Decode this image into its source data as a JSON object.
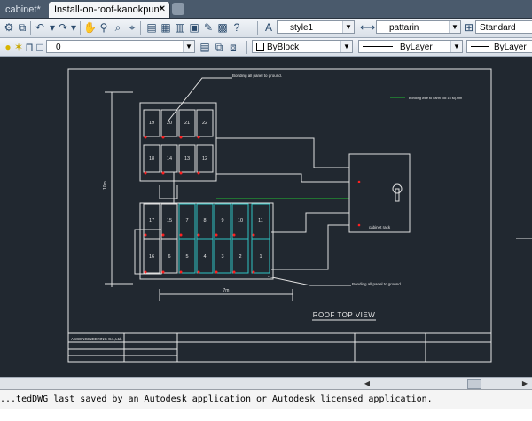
{
  "tabs": [
    {
      "label": "cabinet*",
      "active": false
    },
    {
      "label": "Install-on-roof-kanokpun*",
      "active": true
    }
  ],
  "toolbar": {
    "text_style": "style1",
    "dim_style": "pattarin",
    "table_style": "Standard",
    "layer": "0",
    "color": "ByBlock",
    "linetype": "ByLayer",
    "lineweight": "ByLayer"
  },
  "drawing": {
    "annotation_top": "Bonding all panel to ground.",
    "annotation_bottom": "Bonding all panel to ground.",
    "legend_text": "Bonding wire to earth rod 16 sq.mm",
    "legend_color": "#22bb33",
    "cabinet_label": "cabinet rack",
    "dimension_vertical": "10m",
    "dimension_horizontal": "7m",
    "view_title": "ROOF TOP VIEW",
    "title_block_company": "ASCENGINEERING Co.,Ltd.",
    "panels_upper": [
      "19",
      "20",
      "21",
      "22",
      "18",
      "14",
      "13",
      "12"
    ],
    "panels_lower_top": [
      "17",
      "15",
      "7",
      "8",
      "9",
      "10",
      "11"
    ],
    "panels_lower_bottom": [
      "16",
      "6",
      "5",
      "4",
      "3",
      "2",
      "1"
    ]
  },
  "status": {
    "message": "...tedDWG last saved by an Autodesk application or Autodesk licensed application."
  }
}
